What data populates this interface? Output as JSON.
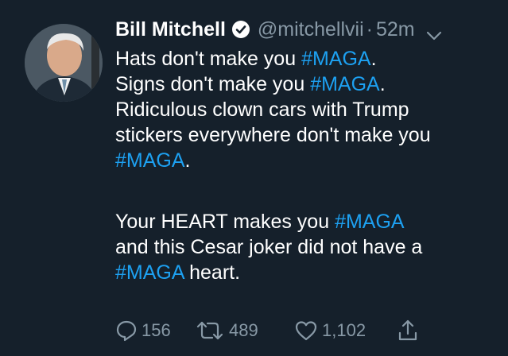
{
  "tweet": {
    "author": {
      "name": "Bill Mitchell",
      "handle": "@mitchellvii",
      "verified": true,
      "avatar_icon": "profile-photo"
    },
    "separator": "·",
    "time": "52m",
    "menu_icon": "chevron-down-icon",
    "paragraphs": [
      [
        {
          "text": "Hats don't make you "
        },
        {
          "text": "#MAGA",
          "hashtag": true
        },
        {
          "text": "."
        },
        {
          "break": true
        },
        {
          "text": "Signs don't make you "
        },
        {
          "text": "#MAGA",
          "hashtag": true
        },
        {
          "text": "."
        },
        {
          "break": true
        },
        {
          "text": "Ridiculous clown cars with Trump"
        },
        {
          "break": true
        },
        {
          "text": "stickers everywhere don't make you"
        },
        {
          "break": true
        },
        {
          "text": "#MAGA",
          "hashtag": true
        },
        {
          "text": "."
        }
      ],
      [
        {
          "text": "Your HEART makes you "
        },
        {
          "text": "#MAGA",
          "hashtag": true
        },
        {
          "break": true
        },
        {
          "text": "and this Cesar joker did not have a"
        },
        {
          "break": true
        },
        {
          "text": "#MAGA",
          "hashtag": true
        },
        {
          "text": " heart."
        }
      ]
    ],
    "stats": {
      "replies": "156",
      "retweets": "489",
      "likes": "1,102"
    }
  },
  "colors": {
    "background": "#15202b",
    "text": "#ffffff",
    "secondary": "#8899a6",
    "accent": "#1da1f2"
  }
}
